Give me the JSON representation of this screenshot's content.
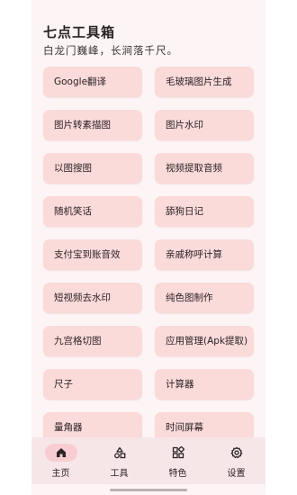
{
  "header": {
    "title": "七点工具箱",
    "subtitle": "白龙门巍峰，长涧落千尺。"
  },
  "tools": [
    "Google翻译",
    "毛玻璃图片生成",
    "图片转素描图",
    "图片水印",
    "以图搜图",
    "视频提取音频",
    "随机笑话",
    "舔狗日记",
    "支付宝到账音效",
    "亲戚称呼计算",
    "短视频去水印",
    "纯色图制作",
    "九宫格切图",
    "应用管理(Apk提取)",
    "尺子",
    "计算器",
    "量角器",
    "时间屏幕"
  ],
  "nav": {
    "items": [
      {
        "label": "主页",
        "icon": "home-icon",
        "active": true
      },
      {
        "label": "工具",
        "icon": "shapes-icon",
        "active": false
      },
      {
        "label": "特色",
        "icon": "widgets-icon",
        "active": false
      },
      {
        "label": "设置",
        "icon": "gear-icon",
        "active": false
      }
    ]
  }
}
